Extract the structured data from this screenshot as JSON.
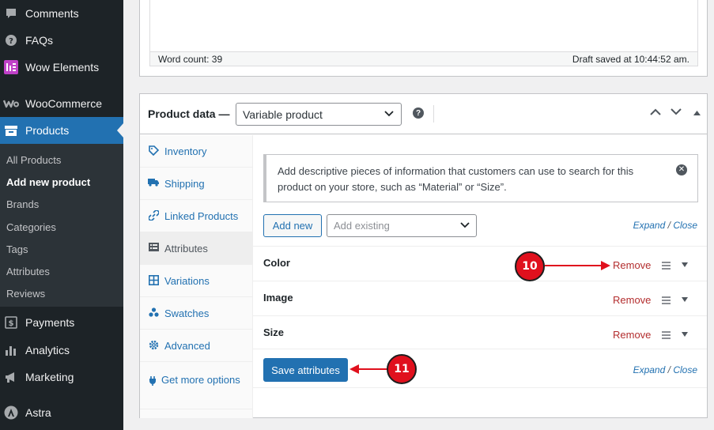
{
  "sidebar": {
    "top_items": [
      {
        "label": "Comments",
        "icon": "comment-icon"
      },
      {
        "label": "FAQs",
        "icon": "question-icon"
      },
      {
        "label": "Wow Elements",
        "icon": "wow-elements-icon"
      },
      {
        "label": "WooCommerce",
        "icon": "woocommerce-icon"
      },
      {
        "label": "Products",
        "icon": "archive-icon"
      }
    ],
    "submenu": [
      {
        "label": "All Products"
      },
      {
        "label": "Add new product"
      },
      {
        "label": "Brands"
      },
      {
        "label": "Categories"
      },
      {
        "label": "Tags"
      },
      {
        "label": "Attributes"
      },
      {
        "label": "Reviews"
      }
    ],
    "bottom_items": [
      {
        "label": "Payments",
        "icon": "payments-icon"
      },
      {
        "label": "Analytics",
        "icon": "chart-bar-icon"
      },
      {
        "label": "Marketing",
        "icon": "megaphone-icon"
      },
      {
        "label": "Astra",
        "icon": "astra-icon"
      }
    ]
  },
  "editor": {
    "word_count": "Word count: 39",
    "draft_saved": "Draft saved at 10:44:52 am."
  },
  "product_data": {
    "title": "Product data —",
    "type_value": "Variable product",
    "help": "?",
    "tabs": [
      {
        "label": "Inventory",
        "icon": "tag-icon"
      },
      {
        "label": "Shipping",
        "icon": "truck-icon"
      },
      {
        "label": "Linked Products",
        "icon": "link-icon"
      },
      {
        "label": "Attributes",
        "icon": "list-icon"
      },
      {
        "label": "Variations",
        "icon": "grid-icon"
      },
      {
        "label": "Swatches",
        "icon": "swatches-icon"
      },
      {
        "label": "Advanced",
        "icon": "gear-icon"
      },
      {
        "label": "Get more options",
        "icon": "plugin-icon"
      }
    ],
    "notice": "Add descriptive pieces of information that customers can use to search for this product on your store, such as “Material” or “Size”.",
    "add_new_label": "Add new",
    "add_existing_placeholder": "Add existing",
    "expand_label": "Expand",
    "close_label": "Close",
    "slash": "/",
    "attributes": [
      {
        "name": "Color",
        "remove_label": "Remove"
      },
      {
        "name": "Image",
        "remove_label": "Remove"
      },
      {
        "name": "Size",
        "remove_label": "Remove"
      }
    ],
    "save_label": "Save attributes"
  },
  "callouts": {
    "step_remove": "10",
    "step_save": "11"
  },
  "colors": {
    "accent": "#2271b1",
    "sidebar_bg": "#1d2327",
    "remove": "#b32d2e",
    "callout": "#e0101d"
  }
}
